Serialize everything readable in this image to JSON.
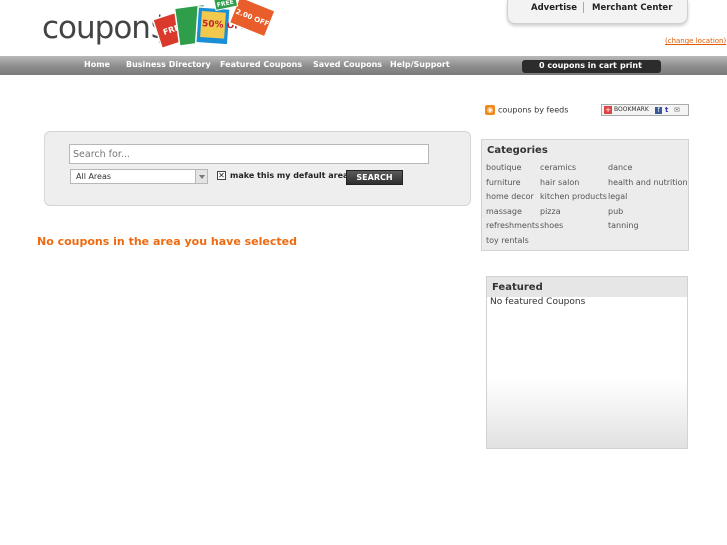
{
  "header": {
    "logo_text": "coupon$",
    "logo_art_text": [
      "FREE",
      "50% OFF",
      "2.00 OFF",
      "FREE"
    ],
    "top_links": [
      "Advertise",
      "Merchant Center"
    ],
    "change_location": "(change location)"
  },
  "nav": {
    "items": [
      "Home",
      "Business Directory",
      "Featured Coupons",
      "Saved Coupons",
      "Help/Support"
    ],
    "cart_label": "0 coupons in cart",
    "print_label": "print"
  },
  "feeds": {
    "label": "coupons by feeds",
    "bookmark_label": "BOOKMARK"
  },
  "search": {
    "placeholder": "Search for...",
    "area_value": "All Areas",
    "default_area_label": "make this my default area",
    "button_label": "SEARCH"
  },
  "main": {
    "message": "No coupons in the area you have selected"
  },
  "categories": {
    "title": "Categories",
    "items": [
      "boutique",
      "ceramics",
      "dance",
      "furniture",
      "hair salon",
      "health and nutrition",
      "home decor",
      "kitchen products",
      "legal",
      "massage",
      "pizza",
      "pub",
      "refreshments",
      "shoes",
      "tanning",
      "toy rentals"
    ]
  },
  "featured": {
    "title": "Featured",
    "empty_text": "No featured Coupons"
  },
  "colors": {
    "accent_orange": "#ee6a10",
    "nav_bar": "#8c8c8c"
  }
}
